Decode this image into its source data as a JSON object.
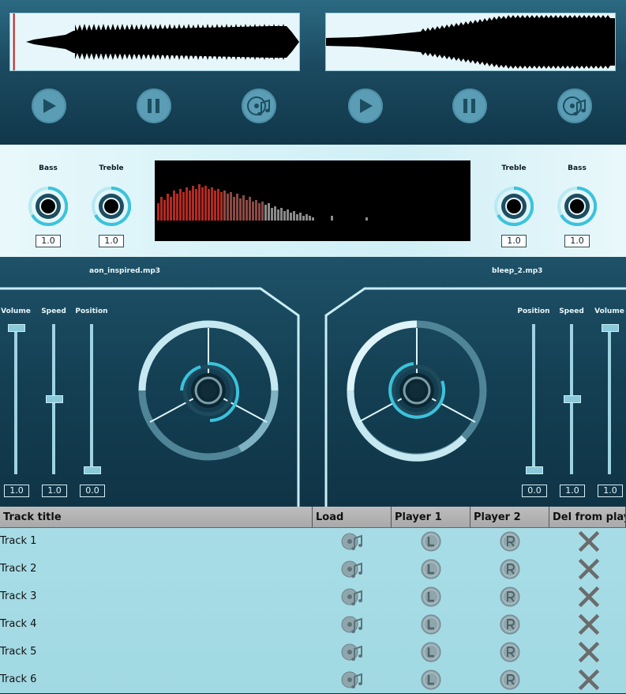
{
  "deck_left": {
    "filename": "aon_inspired.mp3",
    "bass": {
      "label": "Bass",
      "value": "1.0"
    },
    "treble": {
      "label": "Treble",
      "value": "1.0"
    },
    "volume": {
      "label": "Volume",
      "value": "1.0",
      "level": 1.0
    },
    "speed": {
      "label": "Speed",
      "value": "1.0",
      "level": 0.5
    },
    "position": {
      "label": "Position",
      "value": "0.0",
      "level": 0.0
    },
    "playhead_fraction": 0.01
  },
  "deck_right": {
    "filename": "bleep_2.mp3",
    "bass": {
      "label": "Bass",
      "value": "1.0"
    },
    "treble": {
      "label": "Treble",
      "value": "1.0"
    },
    "volume": {
      "label": "Volume",
      "value": "1.0",
      "level": 1.0
    },
    "speed": {
      "label": "Speed",
      "value": "1.0",
      "level": 0.5
    },
    "position": {
      "label": "Position",
      "value": "0.0",
      "level": 0.0
    }
  },
  "playlist": {
    "columns": [
      "Track title",
      "Load",
      "Player 1",
      "Player 2",
      "Del from playlist"
    ],
    "rows": [
      {
        "title": "Track 1"
      },
      {
        "title": "Track 2"
      },
      {
        "title": "Track 3"
      },
      {
        "title": "Track 4"
      },
      {
        "title": "Track 5"
      },
      {
        "title": "Track 6"
      }
    ]
  },
  "icons": {
    "play": "play-icon",
    "pause": "pause-icon",
    "load": "load-music-icon",
    "player1": "player-l-icon",
    "player2": "player-r-icon",
    "delete": "close-icon"
  },
  "colors": {
    "accent": "#3bc3db",
    "knob_ring": "#3bc3db",
    "spectrum_red": "#b22a22",
    "spectrum_gray": "#8a8a8a",
    "delete_x": "#6b6b6b"
  }
}
